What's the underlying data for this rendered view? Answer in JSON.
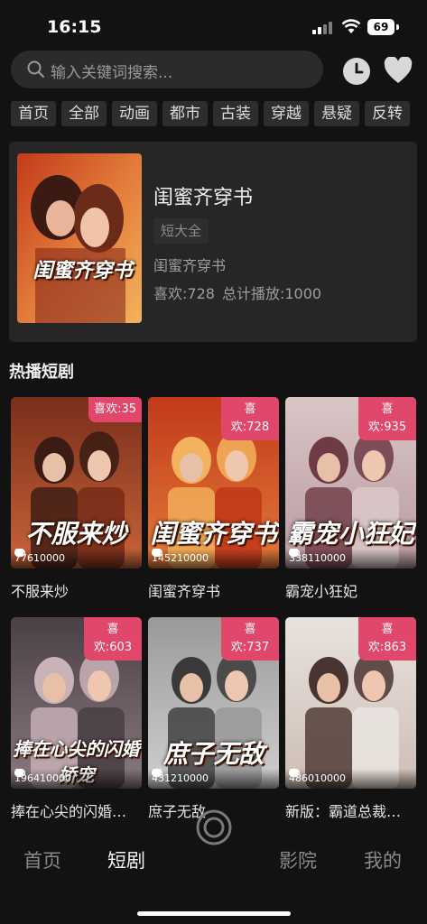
{
  "status": {
    "time": "16:15",
    "battery": "69"
  },
  "search": {
    "placeholder": "输入关键词搜索..."
  },
  "icons": {
    "search": "search-icon",
    "history": "clock-icon",
    "favorites": "heart-icon",
    "center_tab": "ring-icon"
  },
  "categories": [
    "首页",
    "全部",
    "动画",
    "都市",
    "古装",
    "穿越",
    "悬疑",
    "反转"
  ],
  "featured": {
    "title": "闺蜜齐穿书",
    "tag": "短大全",
    "subtitle": "闺蜜齐穿书",
    "likes": "喜欢:728",
    "plays": "总计播放:1000",
    "poster_text": "闺蜜齐穿书"
  },
  "section": {
    "title": "热播短剧"
  },
  "dramas": [
    {
      "title": "不服来炒",
      "badge": "喜欢:35",
      "views": "776",
      "likes": "1000",
      "comments": "0",
      "poster_text": "不服来炒"
    },
    {
      "title": "闺蜜齐穿书",
      "badge": "喜欢:728",
      "views": "1452",
      "likes": "1000",
      "comments": "0",
      "poster_text": "闺蜜齐穿书"
    },
    {
      "title": "霸宠小狂妃",
      "badge": "喜欢:935",
      "views": "3381",
      "likes": "1000",
      "comments": "0",
      "poster_text": "霸宠小狂妃"
    },
    {
      "title": "捧在心尖的闪婚娇宠",
      "badge": "喜欢:603",
      "views": "1964",
      "likes": "1000",
      "comments": "0",
      "poster_text": "捧在心尖的闪婚娇宠"
    },
    {
      "title": "庶子无敌",
      "badge": "喜欢:737",
      "views": "4312",
      "likes": "1000",
      "comments": "0",
      "poster_text": "庶子无敌"
    },
    {
      "title": "新版：霸道总裁爱上我",
      "badge": "喜欢:863",
      "views": "4860",
      "likes": "1000",
      "comments": "0",
      "poster_text": ""
    }
  ],
  "tabs": [
    {
      "label": "首页",
      "active": false
    },
    {
      "label": "短剧",
      "active": true
    },
    {
      "label": "影院",
      "active": false
    },
    {
      "label": "我的",
      "active": false
    }
  ],
  "colors": {
    "background": "#121212",
    "badge": "#e0476a",
    "card": "#262626"
  }
}
